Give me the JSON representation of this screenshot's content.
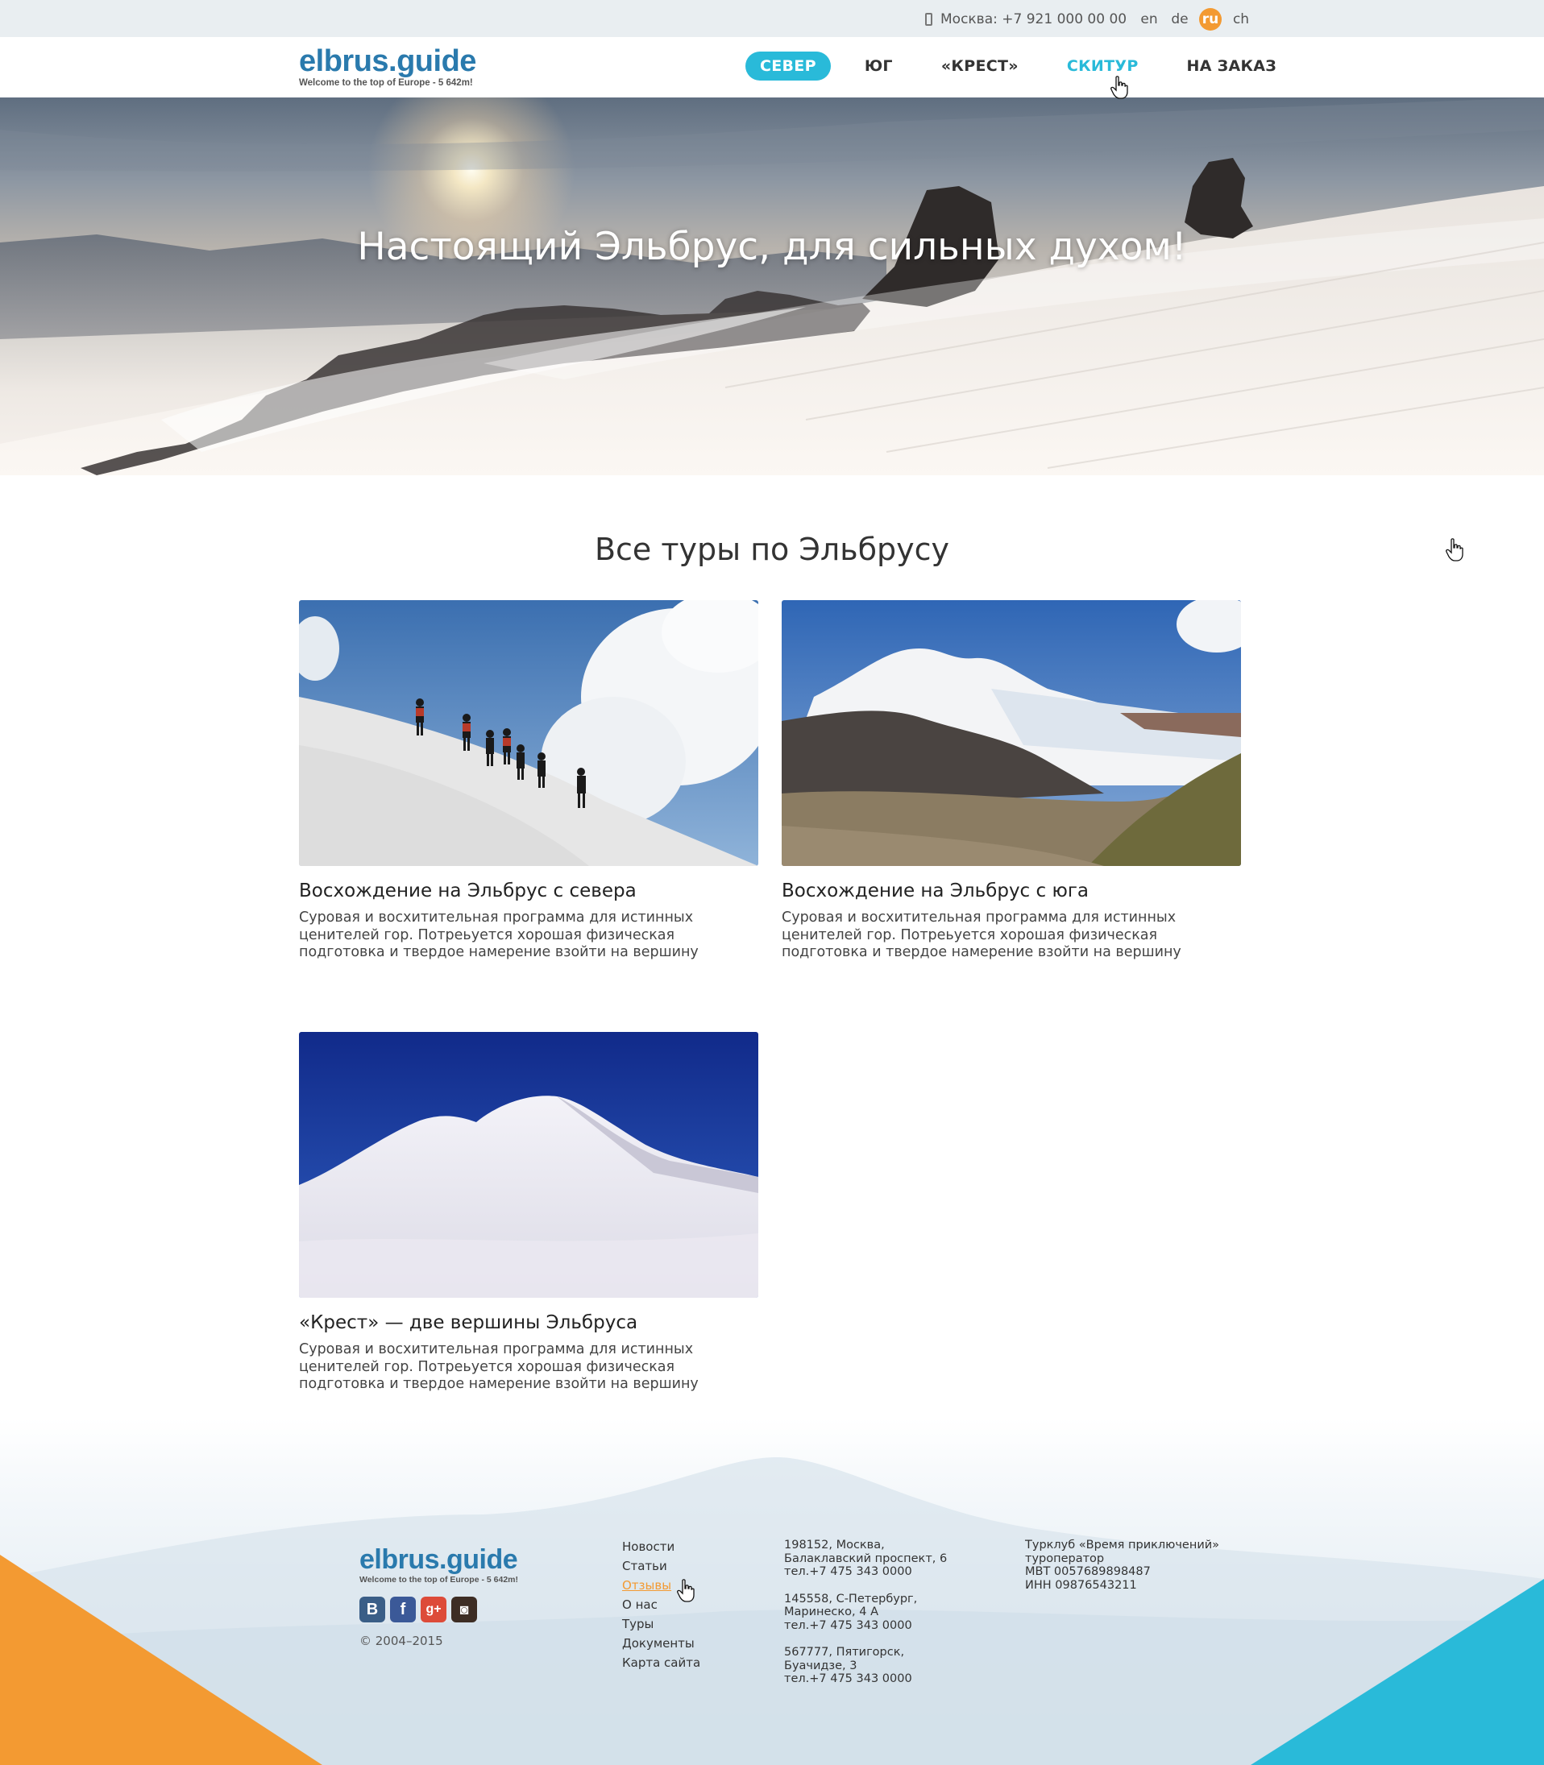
{
  "topbar": {
    "phone": "Москва: +7 921 000 00 00",
    "languages": [
      {
        "code": "en",
        "active": false
      },
      {
        "code": "de",
        "active": false
      },
      {
        "code": "ru",
        "active": true
      },
      {
        "code": "ch",
        "active": false
      }
    ]
  },
  "header": {
    "logo_title": "elbrus.guide",
    "logo_tagline": "Welcome to the top of Europe - 5 642m!",
    "nav": [
      {
        "label": "СЕВЕР",
        "state": "active"
      },
      {
        "label": "ЮГ",
        "state": "normal"
      },
      {
        "label": "«КРЕСТ»",
        "state": "normal"
      },
      {
        "label": "СКИТУР",
        "state": "hover"
      },
      {
        "label": "НА ЗАКАЗ",
        "state": "normal"
      }
    ]
  },
  "hero": {
    "title": "Настоящий Эльбрус, для сильных духом!"
  },
  "tours": {
    "title": "Все туры по Эльбрусу",
    "items": [
      {
        "title": "Восхождение на Эльбрус с севера",
        "description": "Суровая и восхитительная программа для истинных ценителей гор. Потреьуется хорошая физическая подготовка и твердое намерение взойти на вершину"
      },
      {
        "title": "Восхождение на Эльбрус с юга",
        "description": "Суровая и восхитительная программа для истинных ценителей гор. Потреьуется хорошая физическая подготовка и твердое намерение взойти на вершину"
      },
      {
        "title": "«Крест» — две вершины Эльбруса",
        "description": "Суровая и восхитительная программа для истинных ценителей гор. Потреьуется хорошая физическая подготовка и твердое намерение взойти на вершину"
      }
    ]
  },
  "footer": {
    "logo_title": "elbrus.guide",
    "logo_tagline": "Welcome to the top of Europe - 5 642m!",
    "socials": [
      {
        "icon": "vk-icon",
        "glyph": "B",
        "color": "#3a5e87"
      },
      {
        "icon": "facebook-icon",
        "glyph": "f",
        "color": "#3b5998"
      },
      {
        "icon": "google-plus-icon",
        "glyph": "g+",
        "color": "#dd4b39"
      },
      {
        "icon": "instagram-icon",
        "glyph": "◙",
        "color": "#3d2d24"
      }
    ],
    "copyright": "© 2004–2015",
    "menu": [
      {
        "label": "Новости",
        "hover": false
      },
      {
        "label": "Статьи",
        "hover": false
      },
      {
        "label": "Отзывы",
        "hover": true
      },
      {
        "label": "О нас",
        "hover": false
      },
      {
        "label": "Туры",
        "hover": false
      },
      {
        "label": "Документы",
        "hover": false
      },
      {
        "label": "Карта сайта",
        "hover": false
      }
    ],
    "addresses": [
      [
        "198152, Москва,",
        "Балаклавский проспект, 6",
        "тел.+7 475 343 0000"
      ],
      [
        "145558, С-Петербург,",
        "Маринеско, 4 А",
        "тел.+7 475 343 0000"
      ],
      [
        "567777, Пятигорск,",
        "Буачидзе, 3",
        "тел.+7 475 343 0000"
      ]
    ],
    "company": [
      "Турклуб «Время приключений»",
      "туроператор",
      "МВТ 0057689898487",
      "ИНН 09876543211"
    ]
  },
  "colors": {
    "accent_blue": "#29bad9",
    "accent_orange": "#f39a32",
    "logo_blue": "#2a7aad"
  }
}
